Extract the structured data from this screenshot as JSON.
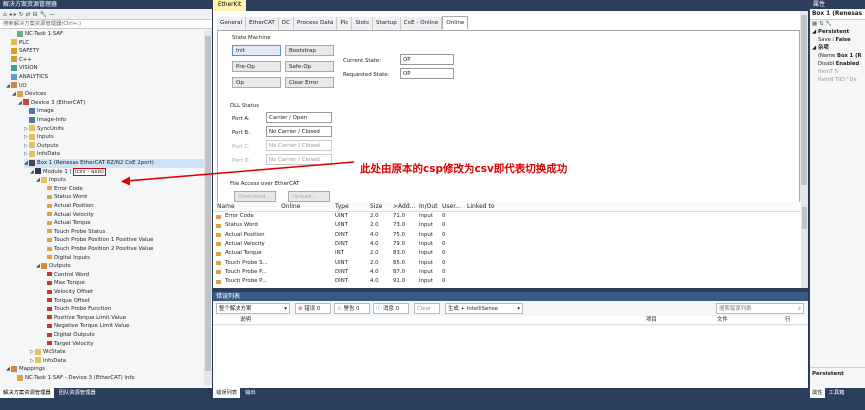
{
  "solution_explorer": {
    "title": "解决方案资源管理器",
    "search_placeholder": "搜索解决方案资源管理器(Ctrl+;)",
    "bottom_tabs": [
      "解决方案资源管理器",
      "团队资源管理器"
    ],
    "tree": [
      {
        "text": "NC-Task 1 SAF",
        "depth": 2,
        "exp": "",
        "icon": "task"
      },
      {
        "text": "PLC",
        "depth": 1,
        "exp": "",
        "icon": "plc"
      },
      {
        "text": "SAFETY",
        "depth": 1,
        "exp": "",
        "icon": "safety"
      },
      {
        "text": "C++",
        "depth": 1,
        "exp": "",
        "icon": "cpp"
      },
      {
        "text": "VISION",
        "depth": 1,
        "exp": "",
        "icon": "vision"
      },
      {
        "text": "ANALYTICS",
        "depth": 1,
        "exp": "",
        "icon": "analytics"
      },
      {
        "text": "I/O",
        "depth": 1,
        "exp": "◢",
        "icon": "io"
      },
      {
        "text": "Devices",
        "depth": 2,
        "exp": "◢",
        "icon": "devices"
      },
      {
        "text": "Device 3 (EtherCAT)",
        "depth": 3,
        "exp": "◢",
        "icon": "ethercat"
      },
      {
        "text": "Image",
        "depth": 4,
        "exp": "",
        "icon": "image"
      },
      {
        "text": "Image-Info",
        "depth": 4,
        "exp": "",
        "icon": "image"
      },
      {
        "text": "SyncUnits",
        "depth": 4,
        "exp": "▷",
        "icon": "folder"
      },
      {
        "text": "Inputs",
        "depth": 4,
        "exp": "▷",
        "icon": "folder"
      },
      {
        "text": "Outputs",
        "depth": 4,
        "exp": "▷",
        "icon": "folder"
      },
      {
        "text": "InfoData",
        "depth": 4,
        "exp": "▷",
        "icon": "folder"
      },
      {
        "text": "Box 1 (Renesas EtherCAT RZ/N2 CoE 2port)",
        "depth": 4,
        "exp": "◢",
        "icon": "box",
        "selected": true
      },
      {
        "text": "Module 1 (",
        "depth": 5,
        "exp": "◢",
        "icon": "module",
        "module": true
      },
      {
        "text": "Inputs",
        "depth": 6,
        "exp": "◢",
        "icon": "folder"
      },
      {
        "text": "Error Code",
        "depth": 7,
        "exp": "",
        "icon": "in"
      },
      {
        "text": "Status Word",
        "depth": 7,
        "exp": "",
        "icon": "in"
      },
      {
        "text": "Actual Position",
        "depth": 7,
        "exp": "",
        "icon": "in"
      },
      {
        "text": "Actual Velocity",
        "depth": 7,
        "exp": "",
        "icon": "in"
      },
      {
        "text": "Actual Torque",
        "depth": 7,
        "exp": "",
        "icon": "in"
      },
      {
        "text": "Touch Probe Status",
        "depth": 7,
        "exp": "",
        "icon": "in"
      },
      {
        "text": "Touch Probe Position 1 Positive Value",
        "depth": 7,
        "exp": "",
        "icon": "in"
      },
      {
        "text": "Touch Probe Position 2 Positive Value",
        "depth": 7,
        "exp": "",
        "icon": "in"
      },
      {
        "text": "Digital Inputs",
        "depth": 7,
        "exp": "",
        "icon": "in"
      },
      {
        "text": "Outputs",
        "depth": 6,
        "exp": "◢",
        "icon": "folderout"
      },
      {
        "text": "Control Word",
        "depth": 7,
        "exp": "",
        "icon": "out"
      },
      {
        "text": "Max Torque",
        "depth": 7,
        "exp": "",
        "icon": "out"
      },
      {
        "text": "Velocity Offset",
        "depth": 7,
        "exp": "",
        "icon": "out"
      },
      {
        "text": "Torque Offset",
        "depth": 7,
        "exp": "",
        "icon": "out"
      },
      {
        "text": "Touch Probe Function",
        "depth": 7,
        "exp": "",
        "icon": "out"
      },
      {
        "text": "Positive Torque Limit Value",
        "depth": 7,
        "exp": "",
        "icon": "out"
      },
      {
        "text": "Negative Torque Limit Value",
        "depth": 7,
        "exp": "",
        "icon": "out"
      },
      {
        "text": "Digital Outputs",
        "depth": 7,
        "exp": "",
        "icon": "out"
      },
      {
        "text": "Target Velocity",
        "depth": 7,
        "exp": "",
        "icon": "out"
      },
      {
        "text": "WcState",
        "depth": 5,
        "exp": "▷",
        "icon": "folder"
      },
      {
        "text": "InfoData",
        "depth": 5,
        "exp": "▷",
        "icon": "folder"
      },
      {
        "text": "Mappings",
        "depth": 1,
        "exp": "◢",
        "icon": "mappings"
      },
      {
        "text": "NC-Task 1 SAF - Device 3 (EtherCAT) Info",
        "depth": 2,
        "exp": "",
        "icon": "mapitem"
      }
    ],
    "module_highlight": "(csv - axis)"
  },
  "document": {
    "title": "EtherKit",
    "tabs": [
      "General",
      "EtherCAT",
      "DC",
      "Process Data",
      "Plc",
      "Slots",
      "Startup",
      "CoE - Online",
      "Online"
    ],
    "active_tab": "Online"
  },
  "state_machine": {
    "title": "State Machine",
    "buttons": [
      "Init",
      "Bootstrap",
      "Pre-Op",
      "Safe-Op",
      "Op",
      "Clear Error"
    ],
    "current_label": "Current State:",
    "current_value": "OP",
    "requested_label": "Requested State:",
    "requested_value": "OP"
  },
  "dll_status": {
    "title": "DLL Status",
    "ports": [
      {
        "label": "Port A:",
        "value": "Carrier / Open"
      },
      {
        "label": "Port B:",
        "value": "No Carrier / Closed"
      },
      {
        "label": "Port C:",
        "value": "No Carrier / Closed"
      },
      {
        "label": "Port D:",
        "value": "No Carrier / Closed"
      }
    ]
  },
  "file_access": {
    "title": "File Access over EtherCAT",
    "download": "Download...",
    "upload": "Upload..."
  },
  "annotation": "此处由原本的csp修改为csv即代表切换成功",
  "io_grid": {
    "columns": [
      "Name",
      "Online",
      "Type",
      "Size",
      ">Add...",
      "In/Out",
      "User...",
      "Linked to"
    ],
    "rows": [
      [
        "Error Code",
        "",
        "UINT",
        "2.0",
        "71.0",
        "Input",
        "0",
        ""
      ],
      [
        "Status Word",
        "",
        "UINT",
        "2.0",
        "73.0",
        "Input",
        "0",
        ""
      ],
      [
        "Actual Position",
        "",
        "DINT",
        "4.0",
        "75.0",
        "Input",
        "0",
        ""
      ],
      [
        "Actual Velocity",
        "",
        "DINT",
        "4.0",
        "79.0",
        "Input",
        "0",
        ""
      ],
      [
        "Actual Torque",
        "",
        "INT",
        "2.0",
        "83.0",
        "Input",
        "0",
        ""
      ],
      [
        "Touch Probe S...",
        "",
        "UINT",
        "2.0",
        "85.0",
        "Input",
        "0",
        ""
      ],
      [
        "Touch Probe P...",
        "",
        "DINT",
        "4.0",
        "87.0",
        "Input",
        "0",
        ""
      ],
      [
        "Touch Probe P...",
        "",
        "DINT",
        "4.0",
        "91.0",
        "Input",
        "0",
        ""
      ]
    ]
  },
  "error_list": {
    "title": "错误列表",
    "scope": "整个解决方案",
    "errors": "错误 0",
    "warnings": "警告 0",
    "messages": "消息 0",
    "clear": "Clear",
    "build": "生成 + IntelliSense",
    "search_placeholder": "搜索错误列表",
    "columns": [
      "",
      "说明",
      "项目",
      "文件",
      "行"
    ],
    "bottom_tabs": [
      "错误列表",
      "输出"
    ]
  },
  "properties": {
    "title": "属性",
    "object": "Box 1 (Renesas",
    "section_persistent": "Persistent",
    "rows": [
      {
        "k": "Save i",
        "v": "False"
      },
      {
        "k": "(Name",
        "v": "Box 1 (R"
      },
      {
        "k": "Disabl",
        "v": "Enabled"
      },
      {
        "k": "ItemT",
        "v": "5"
      },
      {
        "k": "PathN",
        "v": "TIID^De"
      }
    ],
    "section_misc": "杂项",
    "footer": "Persistent",
    "bottom_tabs": [
      "属性",
      "工具箱"
    ]
  }
}
